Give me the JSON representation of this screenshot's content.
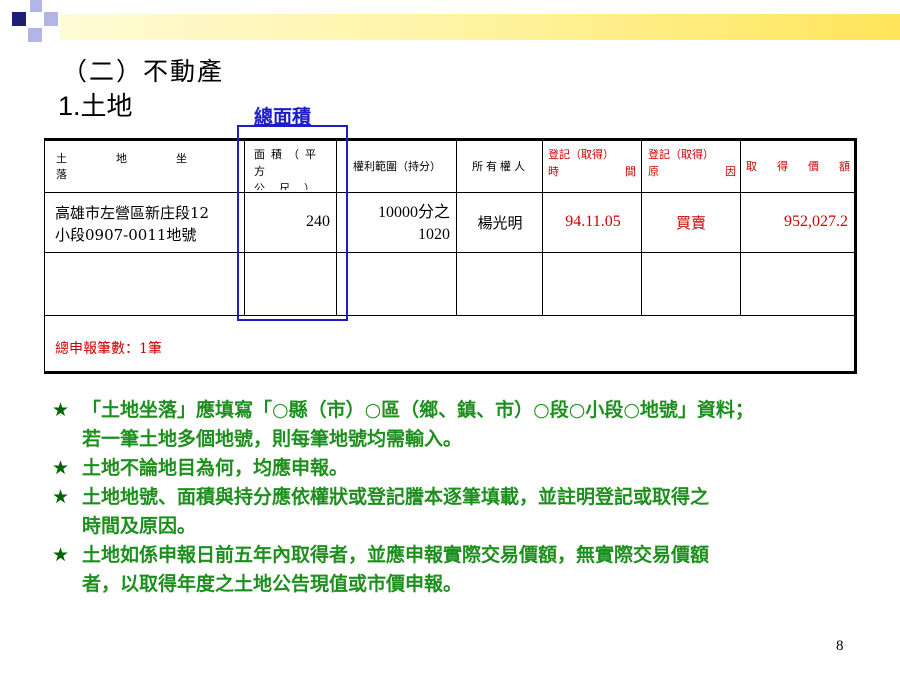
{
  "slide": {
    "subtitle": "（二）不動產",
    "heading_num": "1.",
    "heading_text": "土地",
    "callout": "總面積",
    "page_number": "8"
  },
  "table": {
    "headers": {
      "land_location": "土地坐落",
      "area_line1": "面積（平方",
      "area_line2": "公尺）",
      "scope": "權利範圍（持分）",
      "owner": "所有權人",
      "time_line1": "登記（取得）",
      "time_line2a": "時",
      "time_line2b": "間",
      "reason_line1": "登記（取得）",
      "reason_line2a": "原",
      "reason_line2b": "因",
      "price_chars": [
        "取",
        "得",
        "價",
        "額"
      ]
    },
    "rows": [
      {
        "location_line1": "高雄市左營區新庄段12",
        "location_line2": "小段0907-0011地號",
        "area": "240",
        "scope_line1": "10000分之",
        "scope_line2": "1020",
        "owner": "楊光明",
        "time": "94.11.05",
        "reason": "買賣",
        "price": "952,027.2"
      }
    ],
    "total": "總申報筆數：1筆"
  },
  "notes": [
    {
      "line1": "「土地坐落」應填寫「○縣（市）○區（鄉、鎮、市）○段○小段○地號」資料；",
      "line2": "若一筆土地多個地號，則每筆地號均需輸入。"
    },
    {
      "line1": "土地不論地目為何，均應申報。",
      "line2": ""
    },
    {
      "line1": "土地地號、面積與持分應依權狀或登記謄本逐筆填載，並註明登記或取得之",
      "line2": "時間及原因。"
    },
    {
      "line1": "土地如係申報日前五年內取得者，並應申報實際交易價額，無實際交易價額",
      "line2": "者，以取得年度之土地公告現值或市價申報。"
    }
  ],
  "icons": {
    "bullet": "star-icon",
    "logo": "squares-logo-icon"
  },
  "colors": {
    "accent_blue": "#1c1cc8",
    "red_text": "#cc0000",
    "green_text": "#1e8f1e",
    "navy_square": "#1f1f7a",
    "lavender_square": "#b3b5e6",
    "header_bar": "#ffe55a"
  }
}
